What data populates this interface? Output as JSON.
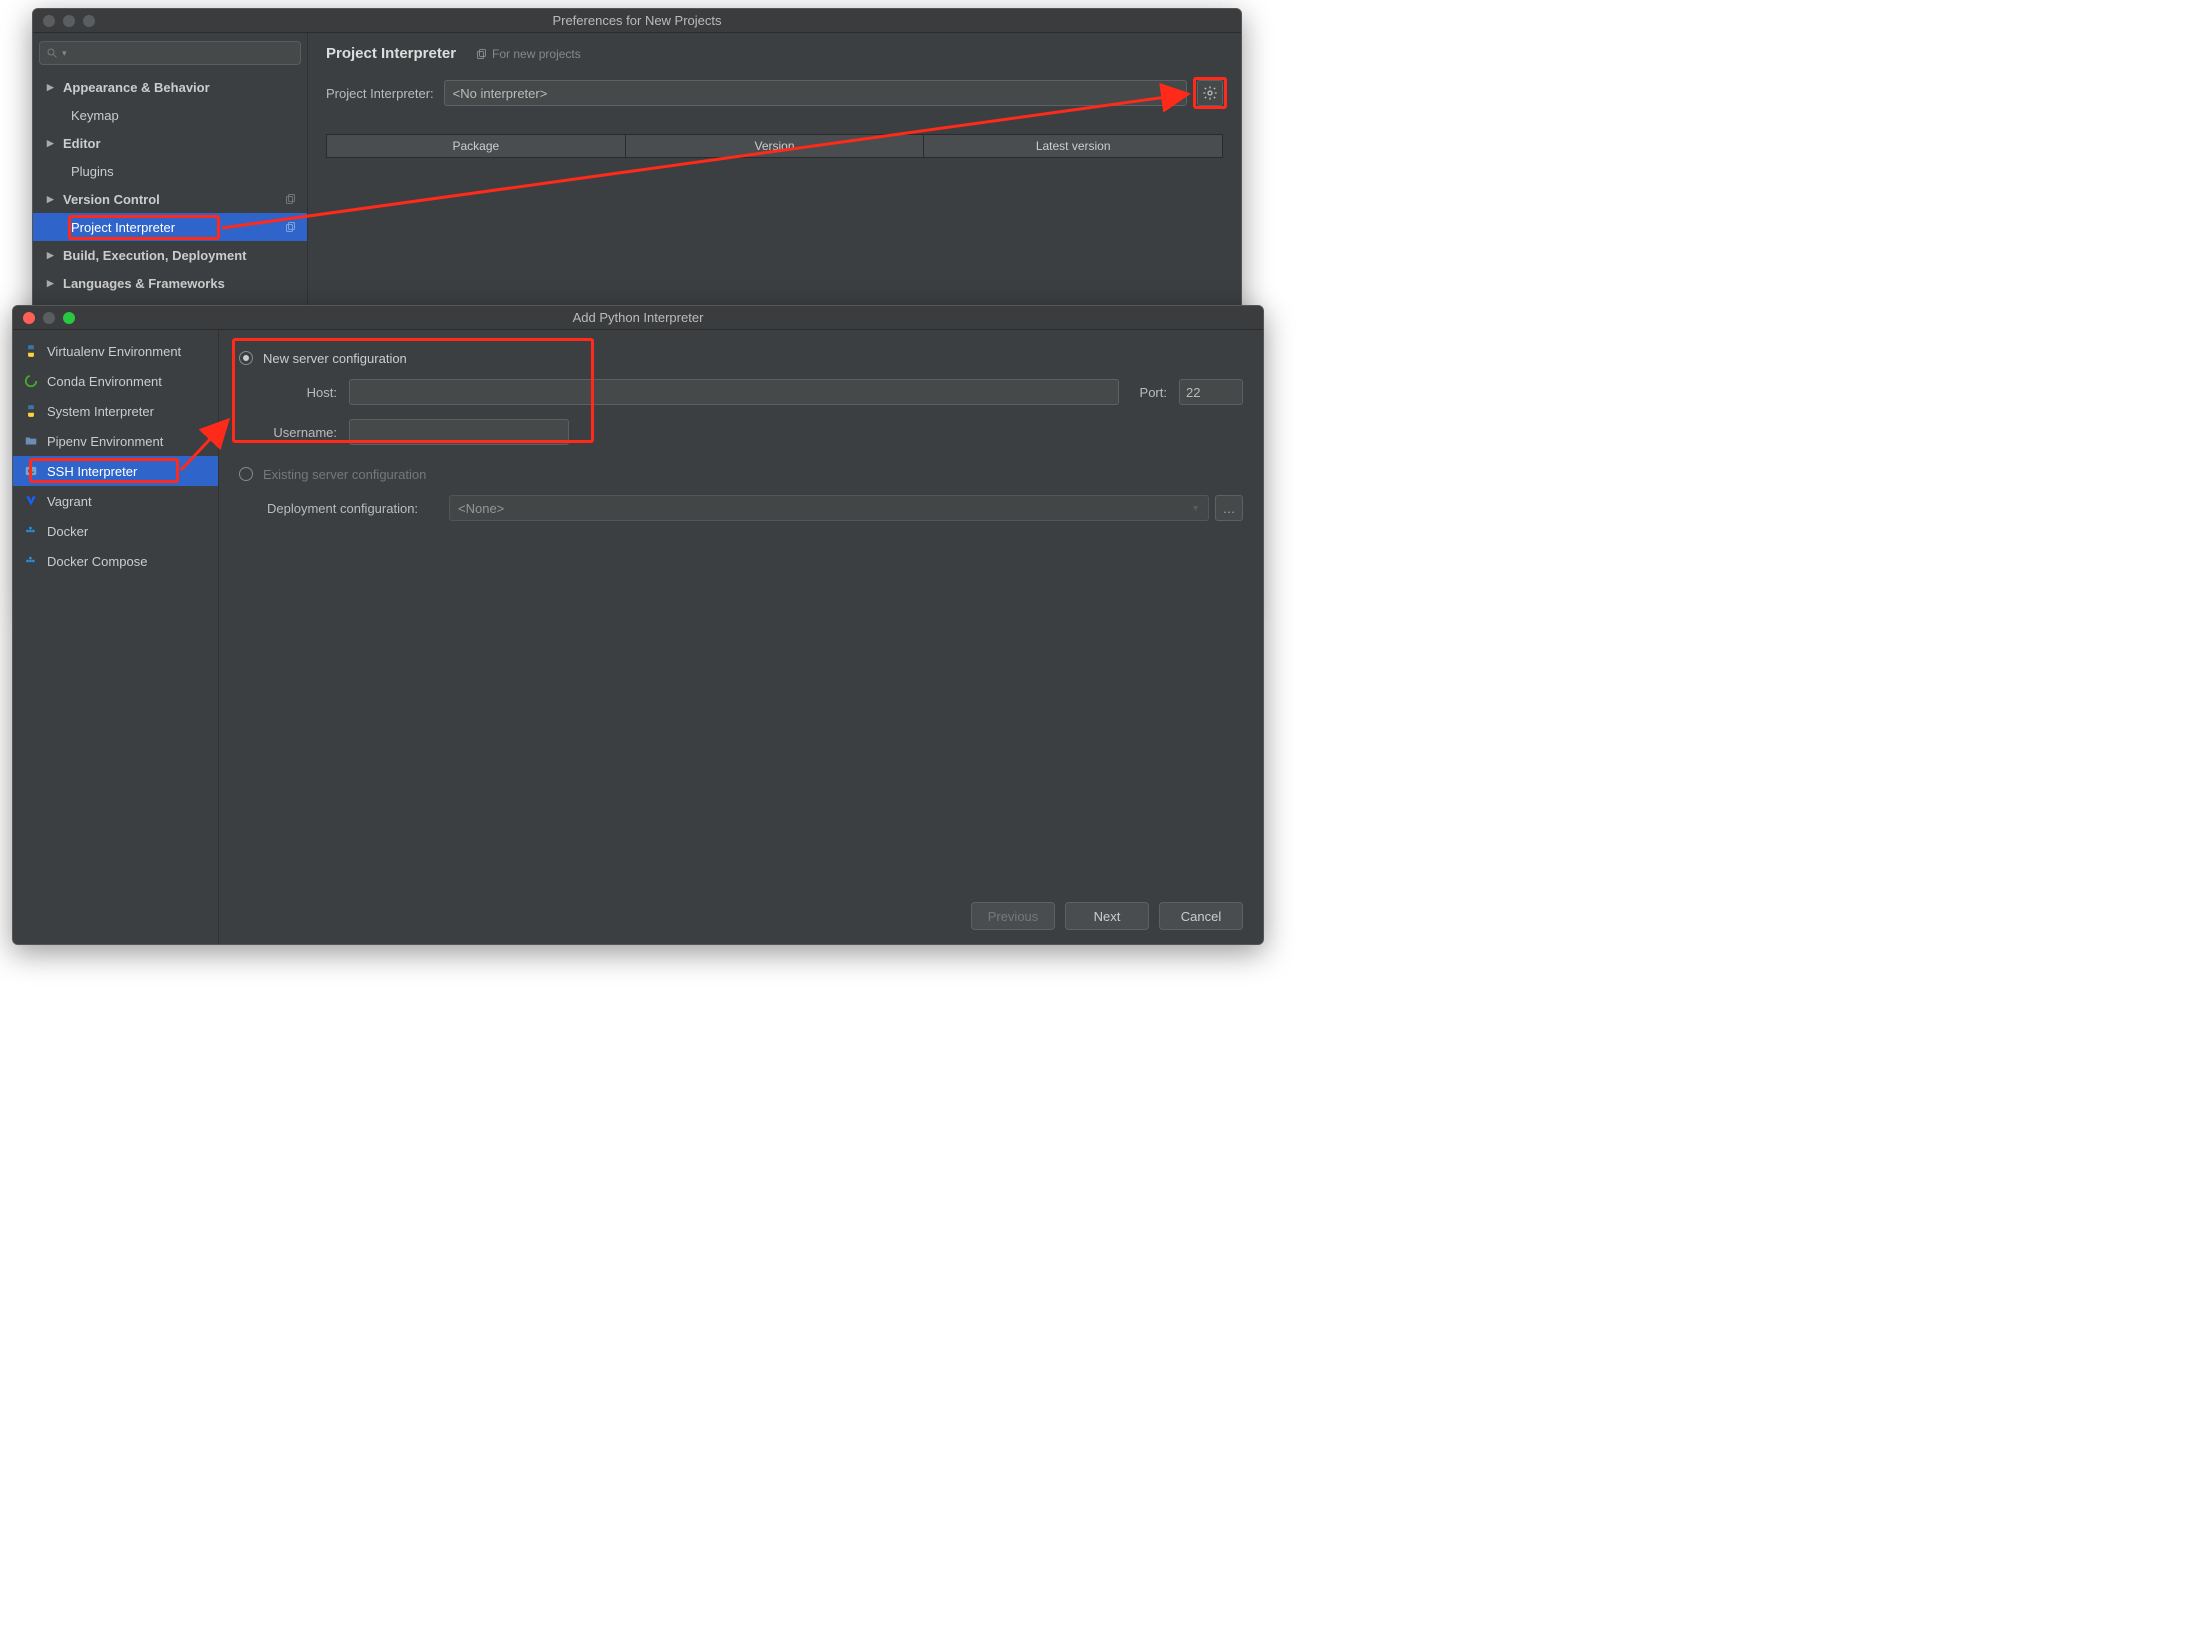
{
  "pref": {
    "title": "Preferences for New Projects",
    "search_placeholder": "",
    "tree": {
      "appearance": "Appearance & Behavior",
      "keymap": "Keymap",
      "editor": "Editor",
      "plugins": "Plugins",
      "version_control": "Version Control",
      "project_interpreter": "Project Interpreter",
      "build": "Build, Execution, Deployment",
      "languages": "Languages & Frameworks"
    },
    "heading": "Project Interpreter",
    "for_new": "For new projects",
    "interp_label": "Project Interpreter:",
    "interp_value": "<No interpreter>",
    "table": {
      "col_package": "Package",
      "col_version": "Version",
      "col_latest": "Latest version"
    }
  },
  "add": {
    "title": "Add Python Interpreter",
    "left": {
      "virtualenv": "Virtualenv Environment",
      "conda": "Conda Environment",
      "system": "System Interpreter",
      "pipenv": "Pipenv Environment",
      "ssh": "SSH Interpreter",
      "vagrant": "Vagrant",
      "docker": "Docker",
      "docker_compose": "Docker Compose"
    },
    "radio_new": "New server configuration",
    "host_label": "Host:",
    "port_label": "Port:",
    "port_value": "22",
    "username_label": "Username:",
    "radio_existing": "Existing server configuration",
    "deploy_label": "Deployment configuration:",
    "deploy_value": "<None>",
    "buttons": {
      "previous": "Previous",
      "next": "Next",
      "cancel": "Cancel"
    }
  }
}
